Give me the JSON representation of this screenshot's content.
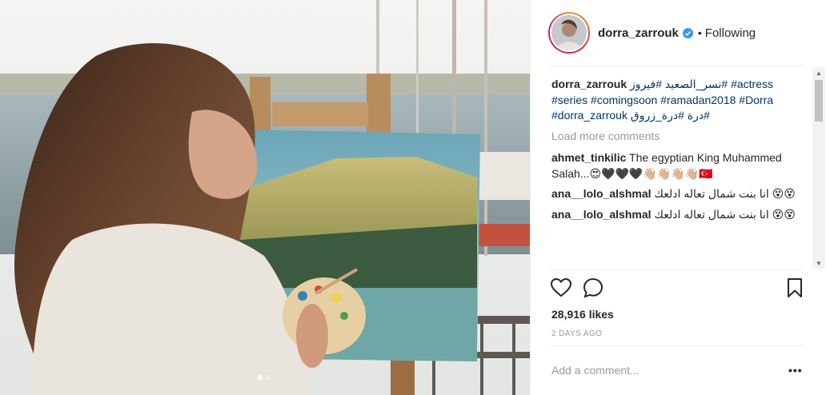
{
  "post": {
    "username": "dorra_zarrouk",
    "separator": "•",
    "following_label": "Following",
    "verified": true,
    "carousel": {
      "count": 2,
      "active": 0
    },
    "caption": {
      "author": "dorra_zarrouk",
      "parts": [
        "#نسر_الصعيد",
        "#فيروز",
        "#actress",
        "#series",
        "#comingsoon",
        "#ramadan2018",
        "#Dorra",
        "#dorra_zarrouk",
        "#درة",
        "#درة_زروق"
      ]
    },
    "load_more_label": "Load more comments",
    "comments": [
      {
        "author": "ahmet_tinkilic",
        "text": "The egyptian King Muhammed Salah...😍🖤🖤🖤👋🏼👋🏼👋🏼👋🏼🇹🇷"
      },
      {
        "author": "ana__lolo_alshmal",
        "text": "انا بنت شمال تعاله ادلعك 😵😵"
      },
      {
        "author": "ana__lolo_alshmal",
        "text": "انا بنت شمال تعاله ادلعك 😵😵"
      }
    ],
    "icons": {
      "like": "heart-icon",
      "comment": "comment-bubble-icon",
      "save": "bookmark-icon",
      "more": "more-options-icon",
      "verified": "verified-badge-icon"
    },
    "likes_label": "28,916 likes",
    "time_label": "2 DAYS AGO",
    "add_comment_placeholder": "Add a comment...",
    "more_label": "•••"
  }
}
